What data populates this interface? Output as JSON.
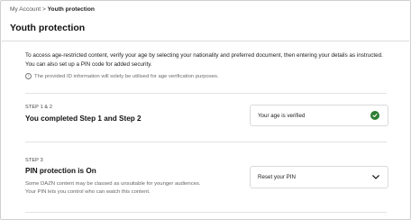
{
  "breadcrumb": {
    "parent": "My Account",
    "separator": ">",
    "current": "Youth protection"
  },
  "page": {
    "title": "Youth protection"
  },
  "intro": {
    "text": "To access age-restricted content, verify your age by selecting your nationality and preferred document, then entering your details as instructed. You can also set up a PIN code for added security.",
    "note": "The provided ID information will solely be utilised for age verification purposes.",
    "note_icon": "info-icon"
  },
  "steps": [
    {
      "label": "STEP 1 & 2",
      "title": "You completed Step 1 and Step 2",
      "status": "Your age is verified",
      "status_icon": "check-circle-icon"
    },
    {
      "label": "STEP 3",
      "title": "PIN protection is On",
      "description": "Some DAZN content may be classed as unsuitable for younger audiences. Your PIN lets you control who can watch this content.",
      "action": "Reset your PIN",
      "action_icon": "chevron-down-icon"
    }
  ],
  "colors": {
    "success": "#2e7d32",
    "border": "#dadada",
    "muted_text": "#666666"
  }
}
